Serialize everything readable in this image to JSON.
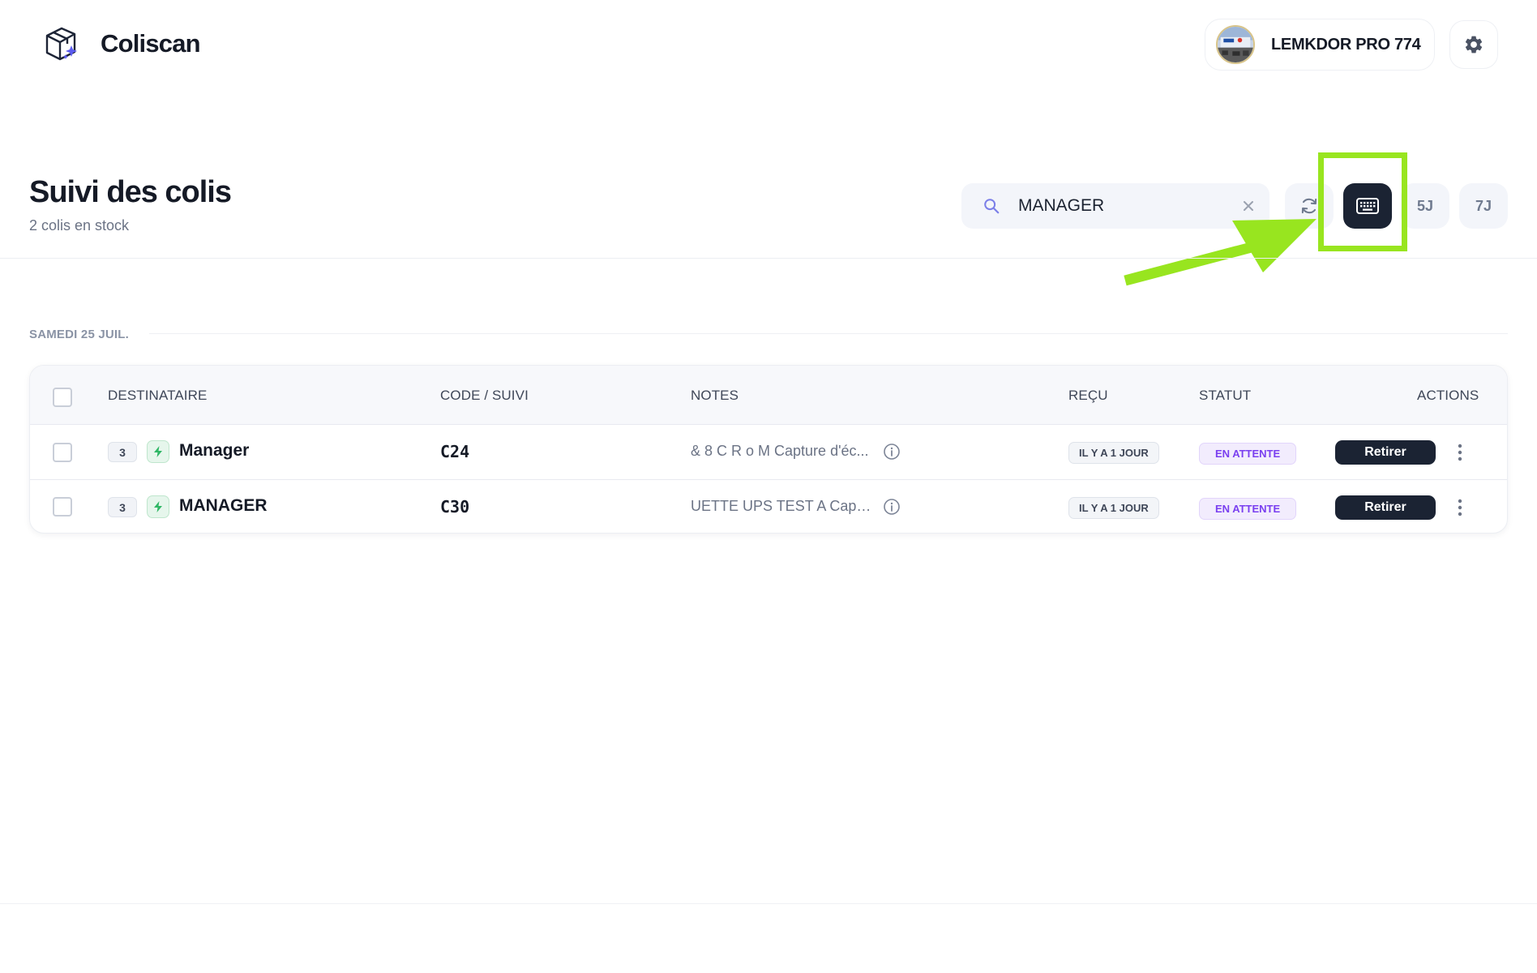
{
  "app": {
    "name": "Coliscan",
    "logo_icon": "package-box-icon"
  },
  "user": {
    "name": "LEMKDOR PRO 774",
    "avatar_icon": "store-photo-avatar"
  },
  "settings": {
    "icon": "gear-icon"
  },
  "page": {
    "title": "Suivi des colis",
    "subtitle": "2 colis en stock"
  },
  "toolbar": {
    "search": {
      "value": "MANAGER",
      "icon": "search-icon",
      "clear_icon": "close-icon"
    },
    "refresh_icon": "refresh-icon",
    "keyboard_icon": "keyboard-icon",
    "btn_5j": "5J",
    "btn_7j": "7J",
    "annotation_color": "#98e51f"
  },
  "group": {
    "date_label": "SAMEDI 25 JUIL."
  },
  "table": {
    "headers": {
      "recipient": "DESTINATAIRE",
      "code": "CODE / SUIVI",
      "notes": "NOTES",
      "received": "REÇU",
      "status": "STATUT",
      "actions": "ACTIONS"
    },
    "rows": [
      {
        "count": "3",
        "recipient": "Manager",
        "code": "C24",
        "note": "& 8 C R o M Capture d'éc...",
        "received": "IL Y A 1 JOUR",
        "status": "EN ATTENTE",
        "action": "Retirer"
      },
      {
        "count": "3",
        "recipient": "MANAGER",
        "code": "C30",
        "note": "UETTE UPS TEST A Captu...",
        "received": "IL Y A 1 JOUR",
        "status": "EN ATTENTE",
        "action": "Retirer"
      }
    ]
  },
  "colors": {
    "primary_dark": "#1b2333",
    "status_purple": "#7a3ff0",
    "bolt_green": "#2fb765",
    "accent_blue": "#5b5bf0"
  }
}
